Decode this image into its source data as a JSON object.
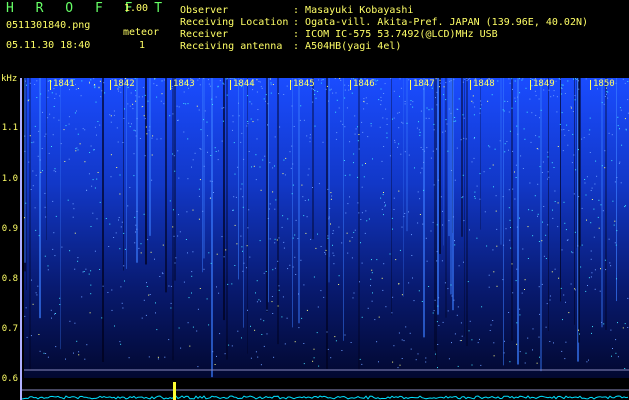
{
  "app": {
    "brand": "H R O F F T",
    "version": "1.00"
  },
  "file": {
    "name": "0511301840.png",
    "datetime": "05.11.30 18:40"
  },
  "meteor": {
    "label": "meteor",
    "count": "1"
  },
  "info": [
    {
      "key": "Observer",
      "value": "Masayuki Kobayashi"
    },
    {
      "key": "Receiving Location",
      "value": "Ogata-vill. Akita-Pref. JAPAN (139.96E, 40.02N)"
    },
    {
      "key": "Receiver",
      "value": "ICOM IC-575 53.7492(@LCD)MHz USB"
    },
    {
      "key": "Receiving antenna",
      "value": "A504HB(yagi 4el)"
    }
  ],
  "axis": {
    "unit": "kHz",
    "y_labels": [
      "1.1",
      "1.0",
      "0.9",
      "0.8",
      "0.7",
      "0.6"
    ],
    "time_ticks": [
      "1841",
      "1842",
      "1843",
      "1844",
      "1845",
      "1846",
      "1847",
      "1848",
      "1849",
      "1850"
    ]
  },
  "colors": {
    "header": "#ffff66",
    "brand": "#66ff66",
    "signal": "#2060ff",
    "baseline": "#00e0ff",
    "marker": "#ffff33"
  }
}
